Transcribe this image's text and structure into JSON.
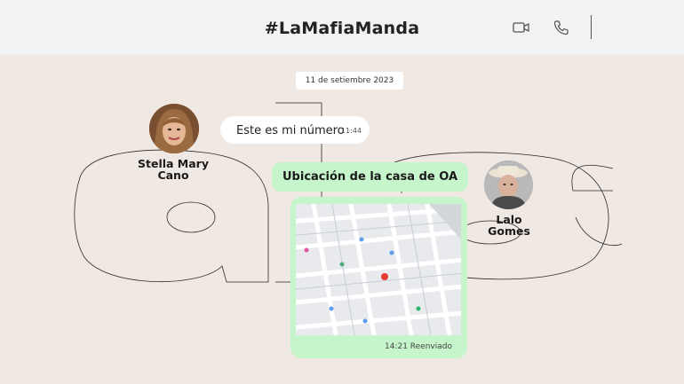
{
  "header": {
    "title": "#LaMafiaManda",
    "icons": [
      "video-call-icon",
      "phone-icon"
    ]
  },
  "chat": {
    "date": "11 de setiembre 2023",
    "participants": [
      {
        "name_line1": "Stella Mary",
        "name_line2": "Cano"
      },
      {
        "name_line1": "Lalo",
        "name_line2": "Gomes"
      }
    ],
    "messages": [
      {
        "text": "Este es mi número",
        "time": "11:44"
      },
      {
        "text": "Ubicación de la casa de OA"
      },
      {
        "footer": "14:21 Reenviado"
      }
    ]
  },
  "colors": {
    "background": "#f0e8e2",
    "header": "#f2f2f2",
    "bubble_green": "#c6f5cb",
    "bubble_white": "#ffffff"
  }
}
